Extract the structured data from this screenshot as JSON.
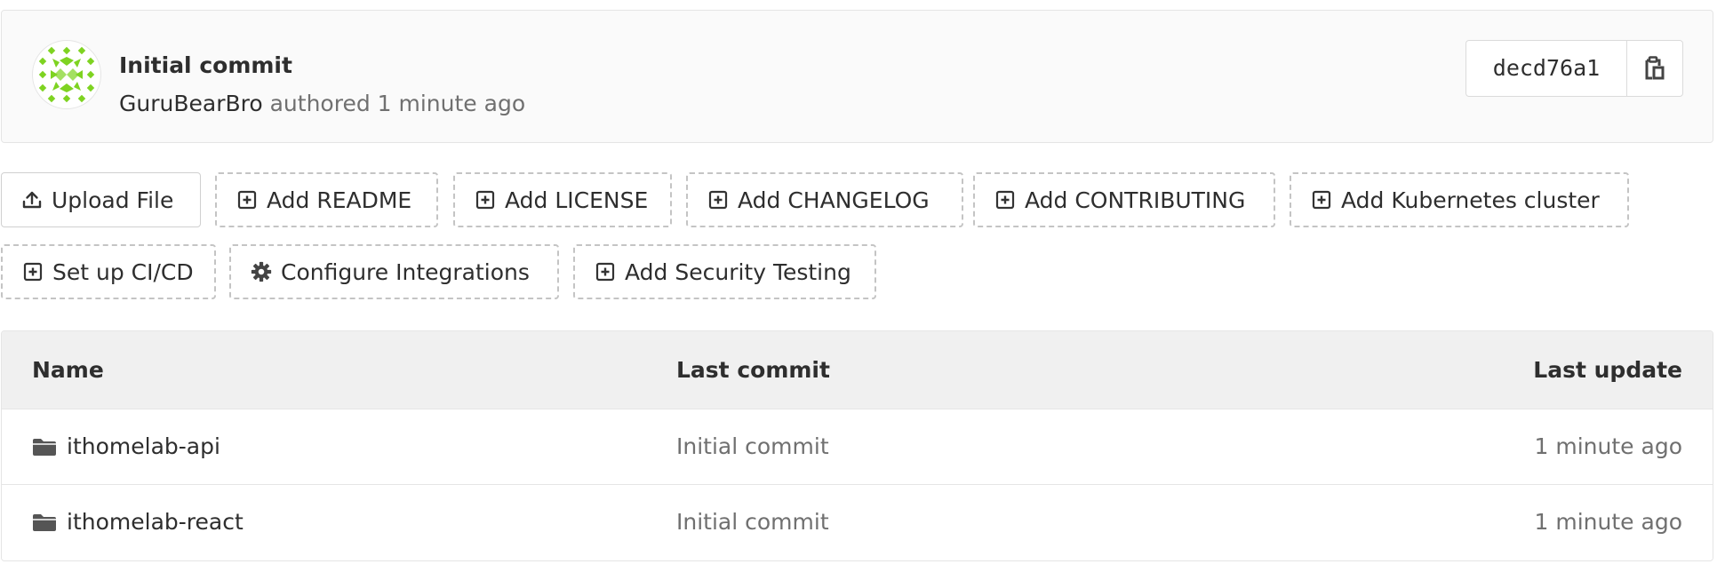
{
  "commit": {
    "title": "Initial commit",
    "author": "GuruBearBro",
    "authored_text": "authored",
    "time": "1 minute ago",
    "sha": "decd76a1",
    "avatar_color": "#7ed321"
  },
  "actions": {
    "upload_file": "Upload File",
    "add_readme": "Add README",
    "add_license": "Add LICENSE",
    "add_changelog": "Add CHANGELOG",
    "add_contributing": "Add CONTRIBUTING",
    "add_kubernetes": "Add Kubernetes cluster",
    "setup_cicd": "Set up CI/CD",
    "configure_integrations": "Configure Integrations",
    "add_security_testing": "Add Security Testing"
  },
  "table": {
    "headers": {
      "name": "Name",
      "last_commit": "Last commit",
      "last_update": "Last update"
    },
    "rows": [
      {
        "name": "ithomelab-api",
        "last_commit": "Initial commit",
        "last_update": "1 minute ago",
        "icon": "folder-icon"
      },
      {
        "name": "ithomelab-react",
        "last_commit": "Initial commit",
        "last_update": "1 minute ago",
        "icon": "folder-icon"
      }
    ]
  }
}
